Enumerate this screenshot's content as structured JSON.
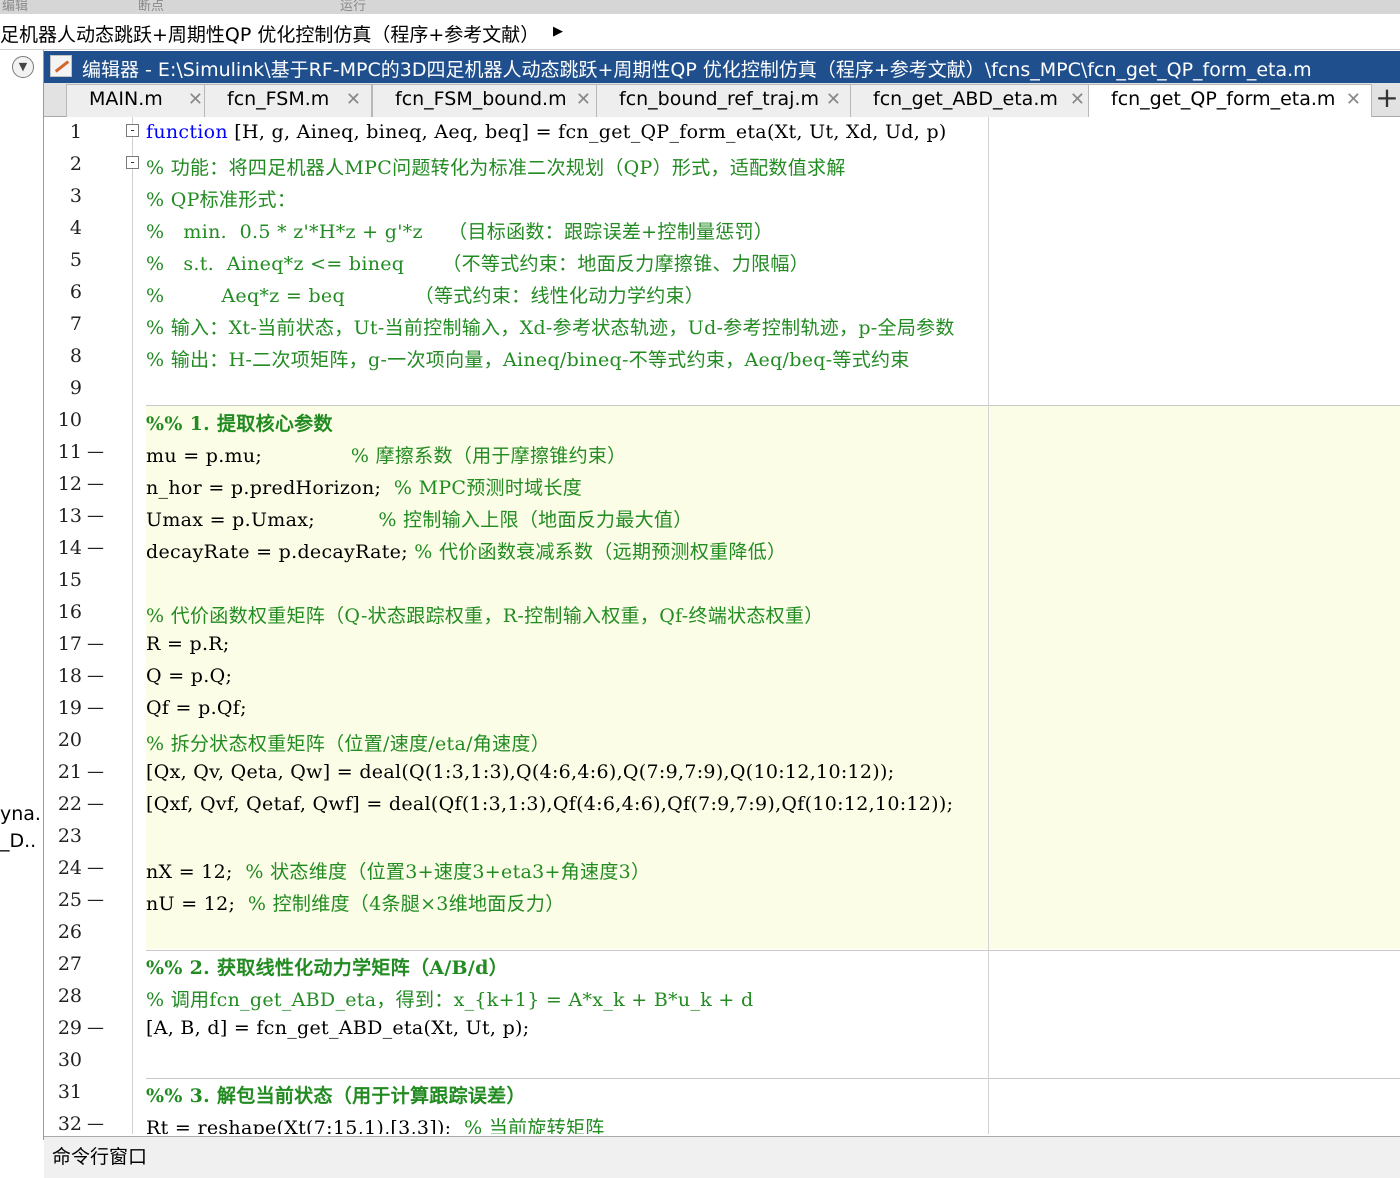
{
  "ribbon": {
    "labels": [
      "编辑",
      "断点",
      "运行"
    ]
  },
  "breadcrumb": {
    "text": "足机器人动态跳跃+周期性QP 优化控制仿真（程序+参考文献）",
    "arrow": "▶"
  },
  "left_panel": {
    "collapse_icon": "▼",
    "truncated_items": [
      "yna.",
      "_D.."
    ]
  },
  "editor_window": {
    "title": "编辑器 - E:\\Simulink\\基于RF-MPC的3D四足机器人动态跳跃+周期性QP 优化控制仿真（程序+参考文献）\\fcns_MPC\\fcn_get_QP_form_eta.m"
  },
  "tabs": [
    {
      "label": "MAIN.m"
    },
    {
      "label": "fcn_FSM.m"
    },
    {
      "label": "fcn_FSM_bound.m"
    },
    {
      "label": "fcn_bound_ref_traj.m"
    },
    {
      "label": "fcn_get_ABD_eta.m"
    },
    {
      "label": "fcn_get_QP_form_eta.m",
      "active": true
    }
  ],
  "tab_close_glyph": "✕",
  "add_tab_glyph": "+",
  "code_lines": [
    {
      "n": "1",
      "dash": "",
      "fold": "-",
      "segments": [
        {
          "t": "function",
          "c": "kw"
        },
        {
          "t": " [H, g, Aineq, bineq, Aeq, beq] = fcn_get_QP_form_eta(Xt, Ut, Xd, Ud, p)",
          "c": ""
        }
      ]
    },
    {
      "n": "2",
      "dash": "",
      "fold": "-",
      "segments": [
        {
          "t": "% 功能：将四足机器人MPC问题转化为标准二次规划（QP）形式，适配数值求解",
          "c": "cm"
        }
      ]
    },
    {
      "n": "3",
      "dash": "",
      "fold": "",
      "segments": [
        {
          "t": "% QP标准形式：",
          "c": "cm"
        }
      ]
    },
    {
      "n": "4",
      "dash": "",
      "fold": "",
      "segments": [
        {
          "t": "%   min.  0.5 * z'*H*z + g'*z    （目标函数：跟踪误差+控制量惩罚）",
          "c": "cm"
        }
      ]
    },
    {
      "n": "5",
      "dash": "",
      "fold": "",
      "segments": [
        {
          "t": "%   s.t.  Aineq*z <= bineq      （不等式约束：地面反力摩擦锥、力限幅）",
          "c": "cm"
        }
      ]
    },
    {
      "n": "6",
      "dash": "",
      "fold": "",
      "segments": [
        {
          "t": "%         Aeq*z = beq           （等式约束：线性化动力学约束）",
          "c": "cm"
        }
      ]
    },
    {
      "n": "7",
      "dash": "",
      "fold": "",
      "segments": [
        {
          "t": "% 输入：Xt-当前状态，Ut-当前控制输入，Xd-参考状态轨迹，Ud-参考控制轨迹，p-全局参数",
          "c": "cm"
        }
      ]
    },
    {
      "n": "8",
      "dash": "",
      "fold": "",
      "segments": [
        {
          "t": "% 输出：H-二次项矩阵，g-一次项向量，Aineq/bineq-不等式约束，Aeq/beq-等式约束",
          "c": "cm"
        }
      ]
    },
    {
      "n": "9",
      "dash": "",
      "fold": "",
      "segments": []
    },
    {
      "n": "10",
      "dash": "",
      "fold": "",
      "segments": [
        {
          "t": "%% 1. 提取核心参数",
          "c": "sec"
        }
      ]
    },
    {
      "n": "11",
      "dash": "—",
      "fold": "",
      "segments": [
        {
          "t": "mu = p.mu;              ",
          "c": ""
        },
        {
          "t": "% 摩擦系数（用于摩擦锥约束）",
          "c": "cm"
        }
      ]
    },
    {
      "n": "12",
      "dash": "—",
      "fold": "",
      "segments": [
        {
          "t": "n_hor = p.predHorizon;  ",
          "c": ""
        },
        {
          "t": "% MPC预测时域长度",
          "c": "cm"
        }
      ]
    },
    {
      "n": "13",
      "dash": "—",
      "fold": "",
      "segments": [
        {
          "t": "Umax = p.Umax;          ",
          "c": ""
        },
        {
          "t": "% 控制输入上限（地面反力最大值）",
          "c": "cm"
        }
      ]
    },
    {
      "n": "14",
      "dash": "—",
      "fold": "",
      "segments": [
        {
          "t": "decayRate = p.decayRate; ",
          "c": ""
        },
        {
          "t": "% 代价函数衰减系数（远期预测权重降低）",
          "c": "cm"
        }
      ]
    },
    {
      "n": "15",
      "dash": "",
      "fold": "",
      "segments": []
    },
    {
      "n": "16",
      "dash": "",
      "fold": "",
      "segments": [
        {
          "t": "% 代价函数权重矩阵（Q-状态跟踪权重，R-控制输入权重，Qf-终端状态权重）",
          "c": "cm"
        }
      ]
    },
    {
      "n": "17",
      "dash": "—",
      "fold": "",
      "segments": [
        {
          "t": "R = p.R;",
          "c": ""
        }
      ]
    },
    {
      "n": "18",
      "dash": "—",
      "fold": "",
      "segments": [
        {
          "t": "Q = p.Q;",
          "c": ""
        }
      ]
    },
    {
      "n": "19",
      "dash": "—",
      "fold": "",
      "segments": [
        {
          "t": "Qf = p.Qf;",
          "c": ""
        }
      ]
    },
    {
      "n": "20",
      "dash": "",
      "fold": "",
      "segments": [
        {
          "t": "% 拆分状态权重矩阵（位置/速度/eta/角速度）",
          "c": "cm"
        }
      ]
    },
    {
      "n": "21",
      "dash": "—",
      "fold": "",
      "segments": [
        {
          "t": "[Qx, Qv, Qeta, Qw] = deal(Q(1:3,1:3),Q(4:6,4:6),Q(7:9,7:9),Q(10:12,10:12));",
          "c": ""
        }
      ]
    },
    {
      "n": "22",
      "dash": "—",
      "fold": "",
      "segments": [
        {
          "t": "[Qxf, Qvf, Qetaf, Qwf] = deal(Qf(1:3,1:3),Qf(4:6,4:6),Qf(7:9,7:9),Qf(10:12,10:12));",
          "c": ""
        }
      ]
    },
    {
      "n": "23",
      "dash": "",
      "fold": "",
      "segments": []
    },
    {
      "n": "24",
      "dash": "—",
      "fold": "",
      "segments": [
        {
          "t": "nX = 12;  ",
          "c": ""
        },
        {
          "t": "% 状态维度（位置3+速度3+eta3+角速度3）",
          "c": "cm"
        }
      ]
    },
    {
      "n": "25",
      "dash": "—",
      "fold": "",
      "segments": [
        {
          "t": "nU = 12;  ",
          "c": ""
        },
        {
          "t": "% 控制维度（4条腿×3维地面反力）",
          "c": "cm"
        }
      ]
    },
    {
      "n": "26",
      "dash": "",
      "fold": "",
      "segments": []
    },
    {
      "n": "27",
      "dash": "",
      "fold": "",
      "segments": [
        {
          "t": "%% 2. 获取线性化动力学矩阵（A/B/d）",
          "c": "sec"
        }
      ]
    },
    {
      "n": "28",
      "dash": "",
      "fold": "",
      "segments": [
        {
          "t": "% 调用fcn_get_ABD_eta，得到：x_{k+1} = A*x_k + B*u_k + d",
          "c": "cm"
        }
      ]
    },
    {
      "n": "29",
      "dash": "—",
      "fold": "",
      "segments": [
        {
          "t": "[A, B, d] = fcn_get_ABD_eta(Xt, Ut, p);",
          "c": ""
        }
      ]
    },
    {
      "n": "30",
      "dash": "",
      "fold": "",
      "segments": []
    },
    {
      "n": "31",
      "dash": "",
      "fold": "",
      "segments": [
        {
          "t": "%% 3. 解包当前状态（用于计算跟踪误差）",
          "c": "sec"
        }
      ]
    },
    {
      "n": "32",
      "dash": "—",
      "fold": "",
      "segments": [
        {
          "t": "Rt = reshape(Xt(7:15,1),[3,3]);  ",
          "c": ""
        },
        {
          "t": "% 当前旋转矩阵",
          "c": "cm"
        }
      ]
    }
  ],
  "command_window": {
    "label": "命令行窗口"
  }
}
